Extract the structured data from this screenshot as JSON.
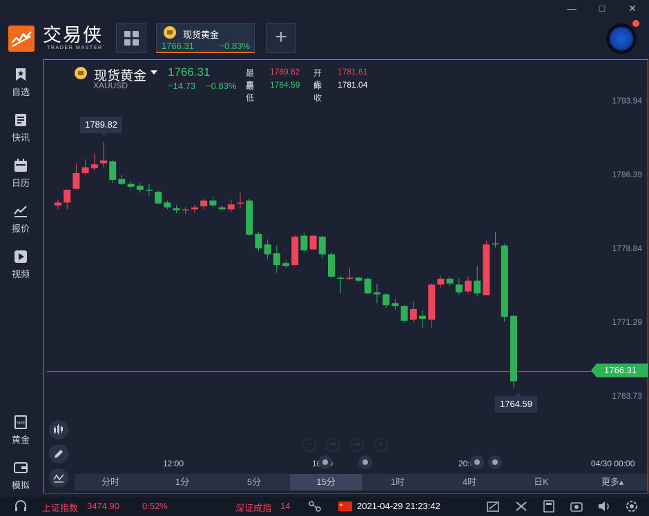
{
  "window": {
    "brand_name": "交易侠",
    "brand_sub": "TRADER MASTER",
    "minimize": "—",
    "maximize": "□",
    "close": "✕"
  },
  "quote_tab": {
    "name": "现货黄金",
    "price": "1766.31",
    "change_pct": "−0.83%"
  },
  "sidebar": {
    "items": [
      {
        "label": "自选",
        "icon": "bookmark-icon"
      },
      {
        "label": "快讯",
        "icon": "news-icon"
      },
      {
        "label": "日历",
        "icon": "calendar-icon"
      },
      {
        "label": "报价",
        "icon": "quote-chart-icon"
      },
      {
        "label": "视频",
        "icon": "video-icon"
      },
      {
        "label": "黄金",
        "icon": "gold-bar-icon"
      },
      {
        "label": "模拟",
        "icon": "wallet-icon"
      }
    ]
  },
  "symbol": {
    "name": "现货黄金",
    "code": "XAUUSD",
    "last": "1766.31",
    "change": "−14.73",
    "change_pct": "−0.83%",
    "high_label": "最高",
    "high": "1789.82",
    "open_label": "开盘",
    "open": "1781.61",
    "low_label": "最低",
    "low": "1764.59",
    "prev_label": "昨收",
    "prev": "1781.04"
  },
  "chart_data": {
    "type": "candlestick",
    "y_ticks": [
      "1793.94",
      "1786.39",
      "1778.84",
      "1771.29",
      "1763.73"
    ],
    "ylim": [
      1763.73,
      1793.94
    ],
    "x_ticks": [
      "12:00",
      "16:00",
      "20:00",
      "04/30 00:00"
    ],
    "last_price_tag": "1766.31",
    "max_label": "1789.82",
    "min_label": "1764.59",
    "colors": {
      "up": "#f0445a",
      "down": "#2db255"
    },
    "candles": [
      {
        "o": 1783.3,
        "h": 1783.9,
        "c": 1783.6,
        "l": 1782.9
      },
      {
        "o": 1783.6,
        "h": 1784.8,
        "c": 1784.9,
        "l": 1782.9
      },
      {
        "o": 1785.0,
        "h": 1787.6,
        "c": 1786.6,
        "l": 1784.9
      },
      {
        "o": 1786.6,
        "h": 1788.0,
        "c": 1787.2,
        "l": 1786.4
      },
      {
        "o": 1787.1,
        "h": 1788.6,
        "c": 1787.5,
        "l": 1786.9
      },
      {
        "o": 1787.6,
        "h": 1789.8,
        "c": 1787.9,
        "l": 1787.2
      },
      {
        "o": 1787.8,
        "h": 1787.9,
        "c": 1785.9,
        "l": 1785.6
      },
      {
        "o": 1786.0,
        "h": 1786.4,
        "c": 1785.5,
        "l": 1785.4
      },
      {
        "o": 1785.5,
        "h": 1785.8,
        "c": 1785.2,
        "l": 1785.0
      },
      {
        "o": 1785.3,
        "h": 1785.6,
        "c": 1784.9,
        "l": 1784.6
      },
      {
        "o": 1784.9,
        "h": 1785.5,
        "c": 1784.8,
        "l": 1784.3
      },
      {
        "o": 1784.7,
        "h": 1784.8,
        "c": 1783.5,
        "l": 1783.4
      },
      {
        "o": 1783.6,
        "h": 1783.8,
        "c": 1783.1,
        "l": 1782.9
      },
      {
        "o": 1783.0,
        "h": 1783.3,
        "c": 1782.8,
        "l": 1782.5
      },
      {
        "o": 1782.8,
        "h": 1783.1,
        "c": 1782.9,
        "l": 1782.4
      },
      {
        "o": 1782.9,
        "h": 1783.4,
        "c": 1783.1,
        "l": 1782.5
      },
      {
        "o": 1783.2,
        "h": 1784.0,
        "c": 1783.8,
        "l": 1782.9
      },
      {
        "o": 1783.8,
        "h": 1784.2,
        "c": 1783.3,
        "l": 1783.1
      },
      {
        "o": 1783.1,
        "h": 1783.3,
        "c": 1782.9,
        "l": 1782.7
      },
      {
        "o": 1782.9,
        "h": 1783.9,
        "c": 1783.4,
        "l": 1782.6
      },
      {
        "o": 1783.5,
        "h": 1784.6,
        "c": 1783.6,
        "l": 1783.0
      },
      {
        "o": 1783.8,
        "h": 1784.0,
        "c": 1780.3,
        "l": 1780.2
      },
      {
        "o": 1780.4,
        "h": 1780.6,
        "c": 1778.9,
        "l": 1778.6
      },
      {
        "o": 1779.3,
        "h": 1779.8,
        "c": 1778.3,
        "l": 1777.8
      },
      {
        "o": 1778.4,
        "h": 1779.2,
        "c": 1777.2,
        "l": 1776.4
      },
      {
        "o": 1777.4,
        "h": 1777.6,
        "c": 1777.1,
        "l": 1776.9
      },
      {
        "o": 1777.2,
        "h": 1780.3,
        "c": 1780.1,
        "l": 1777.1
      },
      {
        "o": 1780.2,
        "h": 1780.5,
        "c": 1778.7,
        "l": 1778.5
      },
      {
        "o": 1778.8,
        "h": 1780.2,
        "c": 1780.2,
        "l": 1778.7
      },
      {
        "o": 1780.1,
        "h": 1780.2,
        "c": 1778.3,
        "l": 1777.9
      },
      {
        "o": 1778.3,
        "h": 1778.5,
        "c": 1776.0,
        "l": 1775.9
      },
      {
        "o": 1775.9,
        "h": 1776.1,
        "c": 1775.8,
        "l": 1774.3
      },
      {
        "o": 1775.8,
        "h": 1776.9,
        "c": 1775.9,
        "l": 1775.7
      },
      {
        "o": 1775.9,
        "h": 1776.0,
        "c": 1775.6,
        "l": 1775.4
      },
      {
        "o": 1775.8,
        "h": 1775.9,
        "c": 1774.3,
        "l": 1774.2
      },
      {
        "o": 1774.4,
        "h": 1775.3,
        "c": 1774.2,
        "l": 1773.3
      },
      {
        "o": 1774.2,
        "h": 1774.3,
        "c": 1773.1,
        "l": 1772.8
      },
      {
        "o": 1773.3,
        "h": 1773.7,
        "c": 1773.0,
        "l": 1772.6
      },
      {
        "o": 1773.0,
        "h": 1773.1,
        "c": 1771.5,
        "l": 1771.3
      },
      {
        "o": 1771.6,
        "h": 1773.5,
        "c": 1772.7,
        "l": 1771.4
      },
      {
        "o": 1772.0,
        "h": 1772.6,
        "c": 1771.7,
        "l": 1770.8
      },
      {
        "o": 1771.6,
        "h": 1775.3,
        "c": 1775.2,
        "l": 1770.8
      },
      {
        "o": 1775.2,
        "h": 1776.1,
        "c": 1775.8,
        "l": 1774.9
      },
      {
        "o": 1775.8,
        "h": 1776.0,
        "c": 1775.3,
        "l": 1775.0
      },
      {
        "o": 1775.2,
        "h": 1775.9,
        "c": 1774.4,
        "l": 1774.1
      },
      {
        "o": 1774.5,
        "h": 1776.0,
        "c": 1775.6,
        "l": 1774.3
      },
      {
        "o": 1775.6,
        "h": 1777.1,
        "c": 1774.3,
        "l": 1774.0
      },
      {
        "o": 1774.1,
        "h": 1779.7,
        "c": 1779.3,
        "l": 1774.1
      },
      {
        "o": 1779.4,
        "h": 1780.6,
        "c": 1779.3,
        "l": 1779.0
      },
      {
        "o": 1779.2,
        "h": 1779.4,
        "c": 1771.9,
        "l": 1771.4
      },
      {
        "o": 1772.0,
        "h": 1772.1,
        "c": 1765.3,
        "l": 1764.6
      }
    ]
  },
  "periods": [
    "分时",
    "1分",
    "5分",
    "15分",
    "1时",
    "4时",
    "日K",
    "更多▴"
  ],
  "active_period": "15分",
  "statusbar": {
    "index1_name": "上证指数",
    "index1_value": "3474.90",
    "index1_pct": "0.52%",
    "index2_name": "深证成指",
    "index2_value": "14",
    "datetime": "2021-04-29 21:23:42"
  }
}
